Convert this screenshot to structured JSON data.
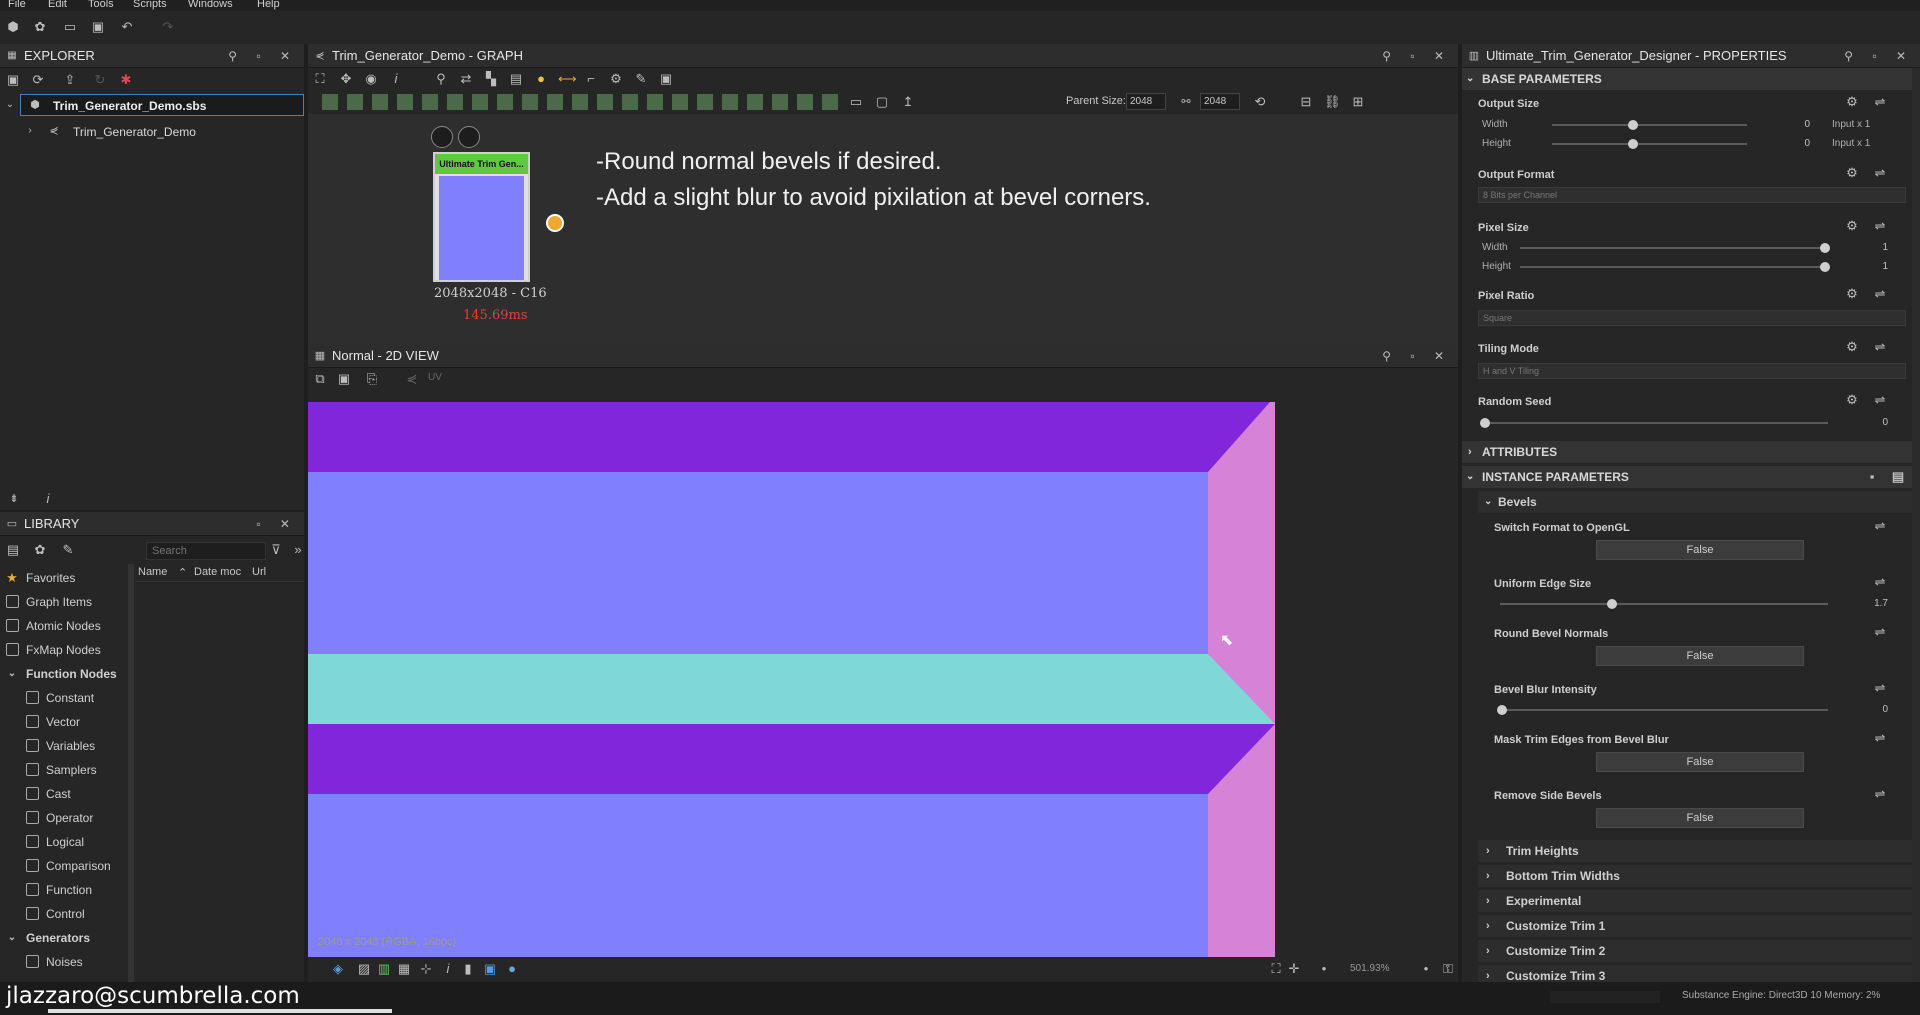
{
  "menu": {
    "file": "File",
    "edit": "Edit",
    "tools": "Tools",
    "scripts": "Scripts",
    "windows": "Windows",
    "help": "Help"
  },
  "explorer": {
    "title": "EXPLORER",
    "file": "Trim_Generator_Demo.sbs",
    "graph": "Trim_Generator_Demo"
  },
  "graph": {
    "title": "Trim_Generator_Demo - GRAPH",
    "parent_size_label": "Parent Size:",
    "size1": "2048",
    "size2": "2048",
    "node_title": "Ultimate Trim Gen...",
    "node_size": "2048x2048 - C16",
    "node_time": "145.69ms",
    "comment1": "-Round normal bevels if desired.",
    "comment2": "-Add a slight blur to avoid pixilation at bevel corners."
  },
  "view2d": {
    "title": "Normal - 2D VIEW",
    "uv": "UV",
    "info": "2048 x 2048 (RGBA, 16bpc)",
    "zoom": "501.93%"
  },
  "library": {
    "title": "LIBRARY",
    "search_placeholder": "Search",
    "col_name": "Name",
    "col_date": "Date moc",
    "col_url": "Url",
    "items": [
      "Favorites",
      "Graph Items",
      "Atomic Nodes",
      "FxMap Nodes",
      "Function Nodes",
      "Constant",
      "Vector",
      "Variables",
      "Samplers",
      "Cast",
      "Operator",
      "Logical",
      "Comparison",
      "Function",
      "Control",
      "Generators",
      "Noises"
    ]
  },
  "props": {
    "title": "Ultimate_Trim_Generator_Designer - PROPERTIES",
    "base": "BASE PARAMETERS",
    "output_size": "Output Size",
    "width": "Width",
    "height": "Height",
    "os_w_val": "0",
    "os_h_val": "0",
    "os_w_suffix": "Input x 1",
    "os_h_suffix": "Input x 1",
    "output_format": "Output Format",
    "output_format_val": "8 Bits per Channel",
    "pixel_size": "Pixel Size",
    "ps_w_val": "1",
    "ps_h_val": "1",
    "pixel_ratio": "Pixel Ratio",
    "pixel_ratio_val": "Square",
    "tiling_mode": "Tiling Mode",
    "tiling_mode_val": "H and V Tiling",
    "random_seed": "Random Seed",
    "random_seed_val": "0",
    "attributes": "ATTRIBUTES",
    "instance": "INSTANCE PARAMETERS",
    "bevels": "Bevels",
    "switch_format": "Switch Format to OpenGL",
    "false": "False",
    "uniform_edge": "Uniform Edge Size",
    "uniform_edge_val": "1.7",
    "round_bevel": "Round Bevel Normals",
    "bevel_blur": "Bevel Blur Intensity",
    "bevel_blur_val": "0",
    "mask_trim": "Mask Trim Edges from Bevel Blur",
    "remove_side": "Remove Side Bevels",
    "trim_heights": "Trim Heights",
    "bottom_trim": "Bottom Trim Widths",
    "experimental": "Experimental",
    "ct1": "Customize Trim 1",
    "ct2": "Customize Trim 2",
    "ct3": "Customize Trim 3"
  },
  "status": {
    "engine": "Substance Engine: Direct3D 10  Memory: 2%"
  },
  "watermark": "jlazzaro@scumbrella.com",
  "colors": {
    "purple": "#8226dc",
    "lavender": "#8080ff",
    "cyan": "#7fd7d7",
    "pink": "#d683d6",
    "node_green": "#5fc93e",
    "accent": "#f0a830"
  }
}
